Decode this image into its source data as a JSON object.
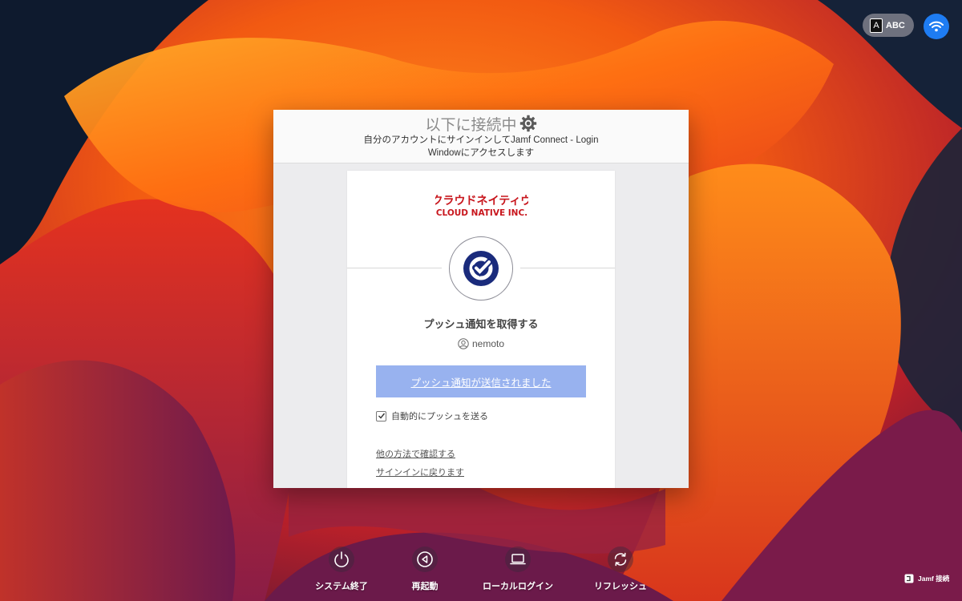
{
  "status_bar": {
    "input_source_glyph": "A",
    "input_source_label": "ABC",
    "wifi_icon": "wifi-icon"
  },
  "login_window": {
    "title": "以下に接続中",
    "title_icon": "gear-icon",
    "subtitle_line1": "自分のアカウントにサインインしてJamf Connect - Login",
    "subtitle_line2": "Windowにアクセスします",
    "card": {
      "logo_line1": "クラウドネイティヴ",
      "logo_line2": "CLOUD NATIVE INC.",
      "verify_icon": "okta-verify-icon",
      "push_title": "プッシュ通知を取得する",
      "username": "nemoto",
      "push_button_label": "プッシュ通知が送信されました",
      "auto_push_label": "自動的にプッシュを送る",
      "auto_push_checked": true,
      "other_method_link": "他の方法で確認する",
      "back_link": "サインインに戻ります"
    }
  },
  "bottom_bar": {
    "shutdown_label": "システム終了",
    "restart_label": "再起動",
    "local_login_label": "ローカルログイン",
    "refresh_label": "リフレッシュ"
  },
  "jamf_badge": {
    "label": "Jamf 接続"
  },
  "colors": {
    "accent_blue": "#1e7cf2",
    "push_button": "#98b2ef",
    "logo_red": "#c8161d",
    "verify_navy": "#1a2b7c"
  }
}
